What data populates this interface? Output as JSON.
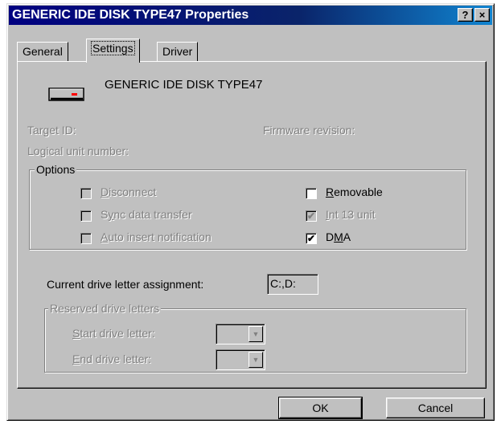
{
  "window": {
    "title": "GENERIC IDE  DISK TYPE47 Properties",
    "help_label": "?",
    "close_label": "×"
  },
  "tabs": [
    {
      "label": "General",
      "active": false
    },
    {
      "label": "Settings",
      "active": true
    },
    {
      "label": "Driver",
      "active": false
    }
  ],
  "device": {
    "icon": "disk-drive-icon",
    "name": "GENERIC IDE  DISK TYPE47"
  },
  "info": {
    "target_id": "Target ID:",
    "firmware_revision": "Firmware revision:",
    "logical_unit": "Logical unit number:"
  },
  "options": {
    "legend": "Options",
    "disconnect": "Disconnect",
    "sync_data_transfer": "Sync data transfer",
    "auto_insert": "Auto insert notification",
    "removable": "Removable",
    "int13_unit": "Int 13 unit",
    "dma": "DMA",
    "state": {
      "disconnect": false,
      "sync_data_transfer": false,
      "auto_insert": false,
      "removable": false,
      "int13_unit": true,
      "dma": true
    }
  },
  "drive_letter": {
    "label": "Current drive letter assignment:",
    "value": "C:,D:"
  },
  "reserved": {
    "legend": "Reserved drive letters",
    "start_label": "Start drive letter:",
    "end_label": "End drive letter:"
  },
  "buttons": {
    "ok": "OK",
    "cancel": "Cancel"
  }
}
